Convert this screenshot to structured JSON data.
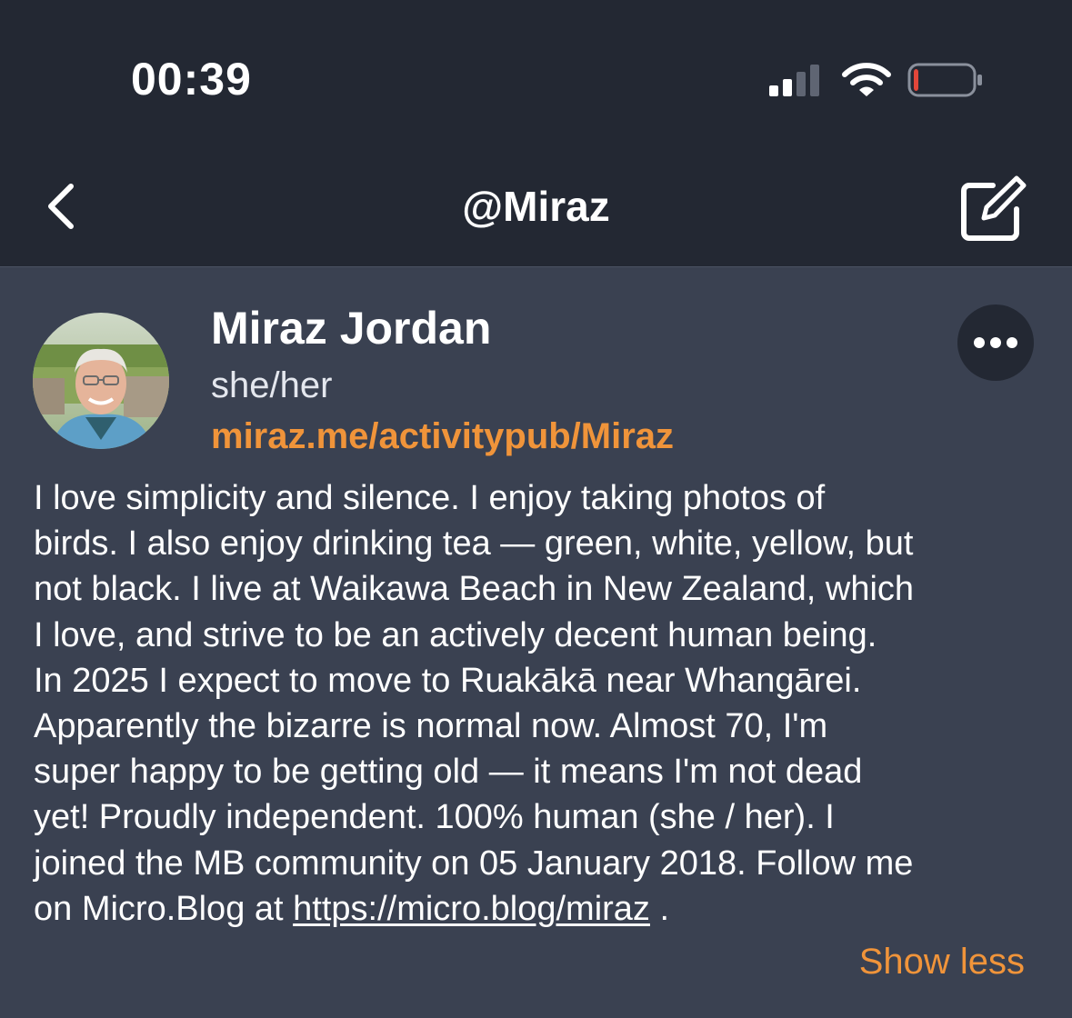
{
  "status_bar": {
    "time": "00:39",
    "signal_icon": "cellular-signal-icon",
    "wifi_icon": "wifi-icon",
    "battery_icon": "battery-icon",
    "battery_level": 0.08,
    "battery_color": "#e2463a"
  },
  "nav": {
    "title": "@Miraz",
    "back_icon": "chevron-left-icon",
    "compose_icon": "compose-icon"
  },
  "profile": {
    "name": "Miraz Jordan",
    "pronouns": "she/her",
    "link": "miraz.me/activitypub/Miraz",
    "more_icon": "ellipsis-icon",
    "bio_lines": [
      "I love simplicity and silence. I enjoy taking photos of",
      "birds. I also enjoy drinking tea — green, white, yellow, but",
      "not black. I live at Waikawa Beach in New Zealand, which",
      "I love, and strive to be an actively decent human being.",
      "In 2025 I expect to move to Ruakākā near Whangārei.",
      "Apparently the bizarre is normal now. Almost 70, I'm",
      "super happy to be getting old — it means I'm not dead",
      "yet! Proudly independent. 100% human (she / her). I",
      "joined the MB community on 05 January 2018. Follow me"
    ],
    "bio_last_prefix": "on Micro.Blog at ",
    "bio_last_link": "https://micro.blog/miraz",
    "bio_last_suffix": " .",
    "show_less": "Show less"
  },
  "colors": {
    "accent": "#f0943a",
    "header_bg": "#232833",
    "content_bg": "#3a4151"
  }
}
